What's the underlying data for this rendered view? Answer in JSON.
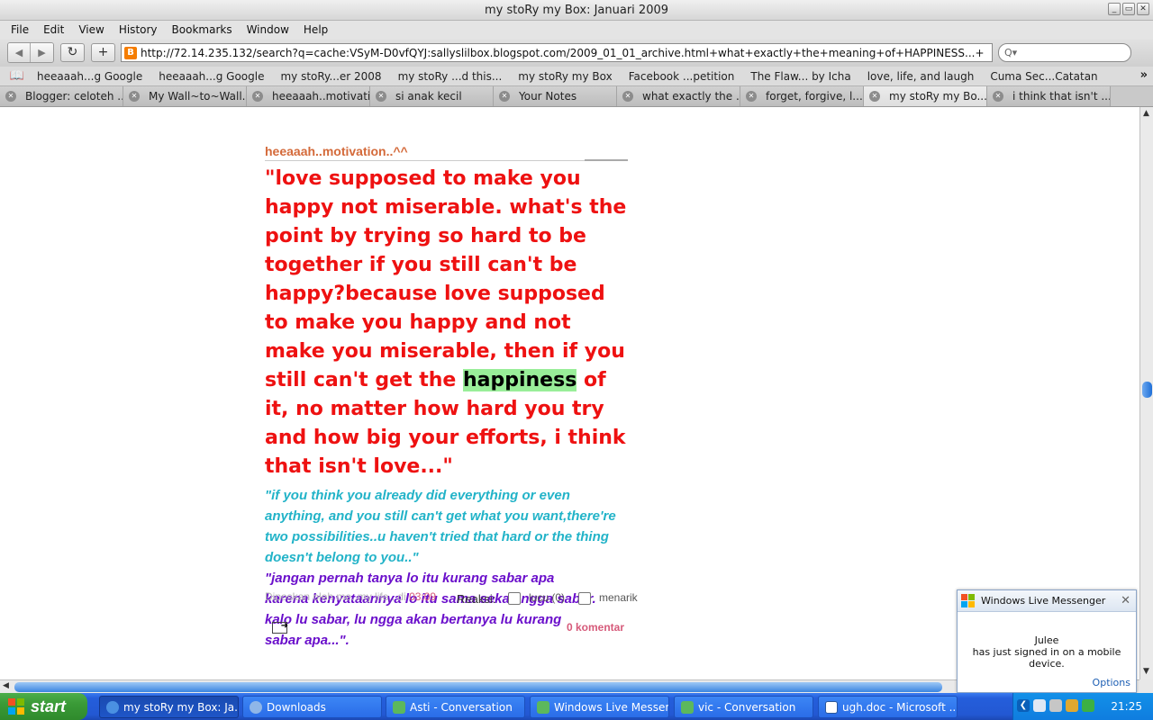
{
  "window": {
    "title": "my stoRy my Box: Januari 2009",
    "buttons": [
      "_",
      "▭",
      "✕"
    ]
  },
  "menu": [
    "File",
    "Edit",
    "View",
    "History",
    "Bookmarks",
    "Window",
    "Help"
  ],
  "toolbar": {
    "back": "◀",
    "forward": "▶",
    "reload": "↻",
    "add": "+",
    "url": "http://72.14.235.132/search?q=cache:VSyM-D0vfQYJ:sallyslilbox.blogspot.com/2009_01_01_archive.html+what+exactly+the+meaning+of+HAPPINESS...+",
    "search_placeholder": "Q▾"
  },
  "bookmarks": [
    "heeaaah...g Google",
    "heeaaah...g Google",
    "my stoRy...er 2008",
    "my stoRy ...d this...",
    "my stoRy my Box",
    "Facebook ...petition",
    "The Flaw... by Icha",
    "love, life, and laugh",
    "Cuma Sec...Catatan"
  ],
  "tabs": [
    "Blogger: celoteh ...",
    "My Wall~to~Wall...",
    "heeaaah..motivati...",
    "si anak kecil",
    "Your Notes",
    "what exactly the ...",
    "forget, forgive, l...",
    "my stoRy my Bo...",
    "i think that isn't ..."
  ],
  "post": {
    "title": "heeaaah..motivation..^^",
    "quote_red_before": "\"love supposed to make you happy not miserable. what's the point by trying so hard to be together if you still can't be happy?because love supposed to make you happy and not make you miserable, then if you still can't get the ",
    "quote_red_highlight": "happiness",
    "quote_red_after": " of it, no matter how hard you try and how big your efforts, i think that isn't love...\"",
    "quote_cyan": "\"if you think you already did everything or even anything, and you still can't get what you want,there're two possibilities..u haven't tried that hard or the thing doesn't belong to you..\"",
    "quote_purple": "\"jangan pernah tanya lo itu kurang sabar apa karena kenyataannya lo itu sama sekali ngga sabar. kalo lu sabar, lu ngga akan bertanya lu kurang sabar apa...\".",
    "posted_by": "Diposkan oleh me..my life.. di ",
    "time": "03:09",
    "reaksi": "Reaksi:",
    "reaction1": "lucu (0)",
    "reaction2": "menarik",
    "comments": "0 komentar"
  },
  "messenger": {
    "app": "Windows Live Messenger",
    "name": "Julee",
    "message": "has just signed in on a mobile device.",
    "options": "Options"
  },
  "taskbar": {
    "start": "start",
    "tasks": [
      "my stoRy my Box: Ja...",
      "Downloads",
      "Asti - Conversation",
      "Windows Live Messen...",
      "vic - Conversation",
      "ugh.doc - Microsoft ..."
    ],
    "clock": "21:25"
  }
}
